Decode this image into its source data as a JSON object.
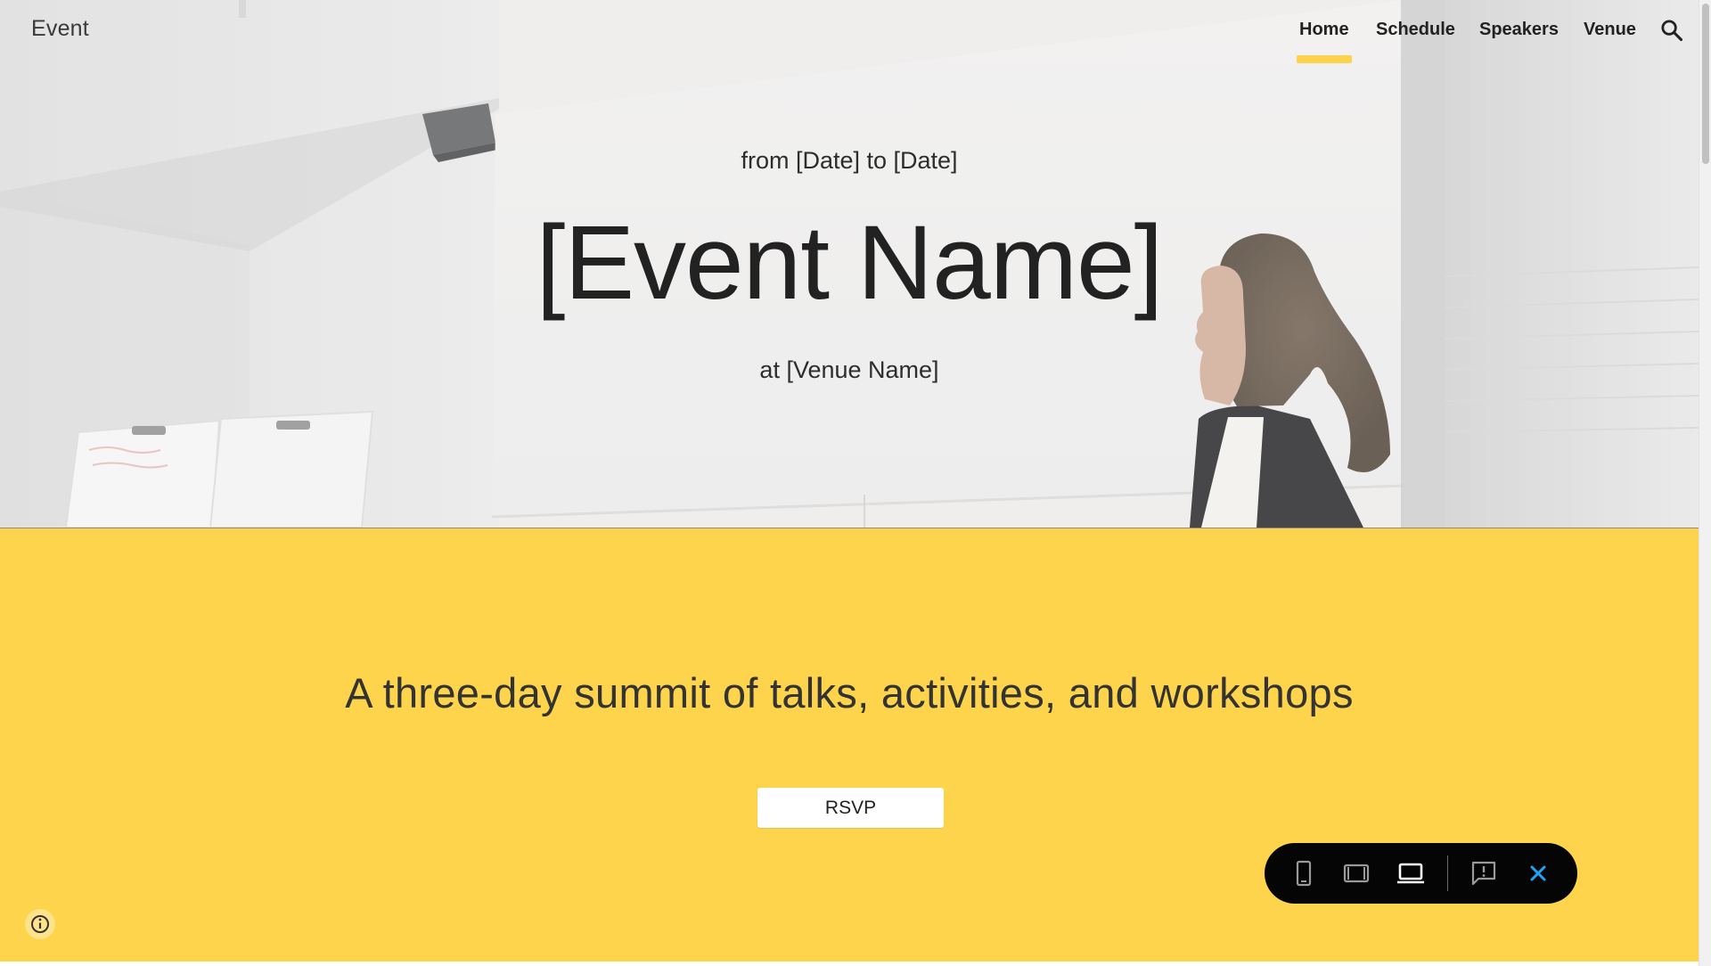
{
  "site": {
    "title": "Event"
  },
  "nav": {
    "items": [
      {
        "label": "Home",
        "active": true
      },
      {
        "label": "Schedule",
        "active": false
      },
      {
        "label": "Speakers",
        "active": false
      },
      {
        "label": "Venue",
        "active": false
      }
    ],
    "search_icon": "search-icon"
  },
  "hero": {
    "date_line": "from [Date] to [Date]",
    "event_name": "[Event Name]",
    "venue_line": "at [Venue Name]"
  },
  "summit": {
    "tagline": "A three-day summit of talks, activities, and workshops",
    "rsvp_label": "RSVP",
    "info_icon": "info-icon"
  },
  "preview_toolbar": {
    "buttons": [
      "phone-view-icon",
      "tablet-view-icon",
      "laptop-view-icon",
      "report-issue-icon",
      "close-icon"
    ]
  },
  "colors": {
    "accent_yellow": "#fed44c",
    "toolbar_bg": "#050505",
    "close_blue": "#1aa5f5"
  }
}
